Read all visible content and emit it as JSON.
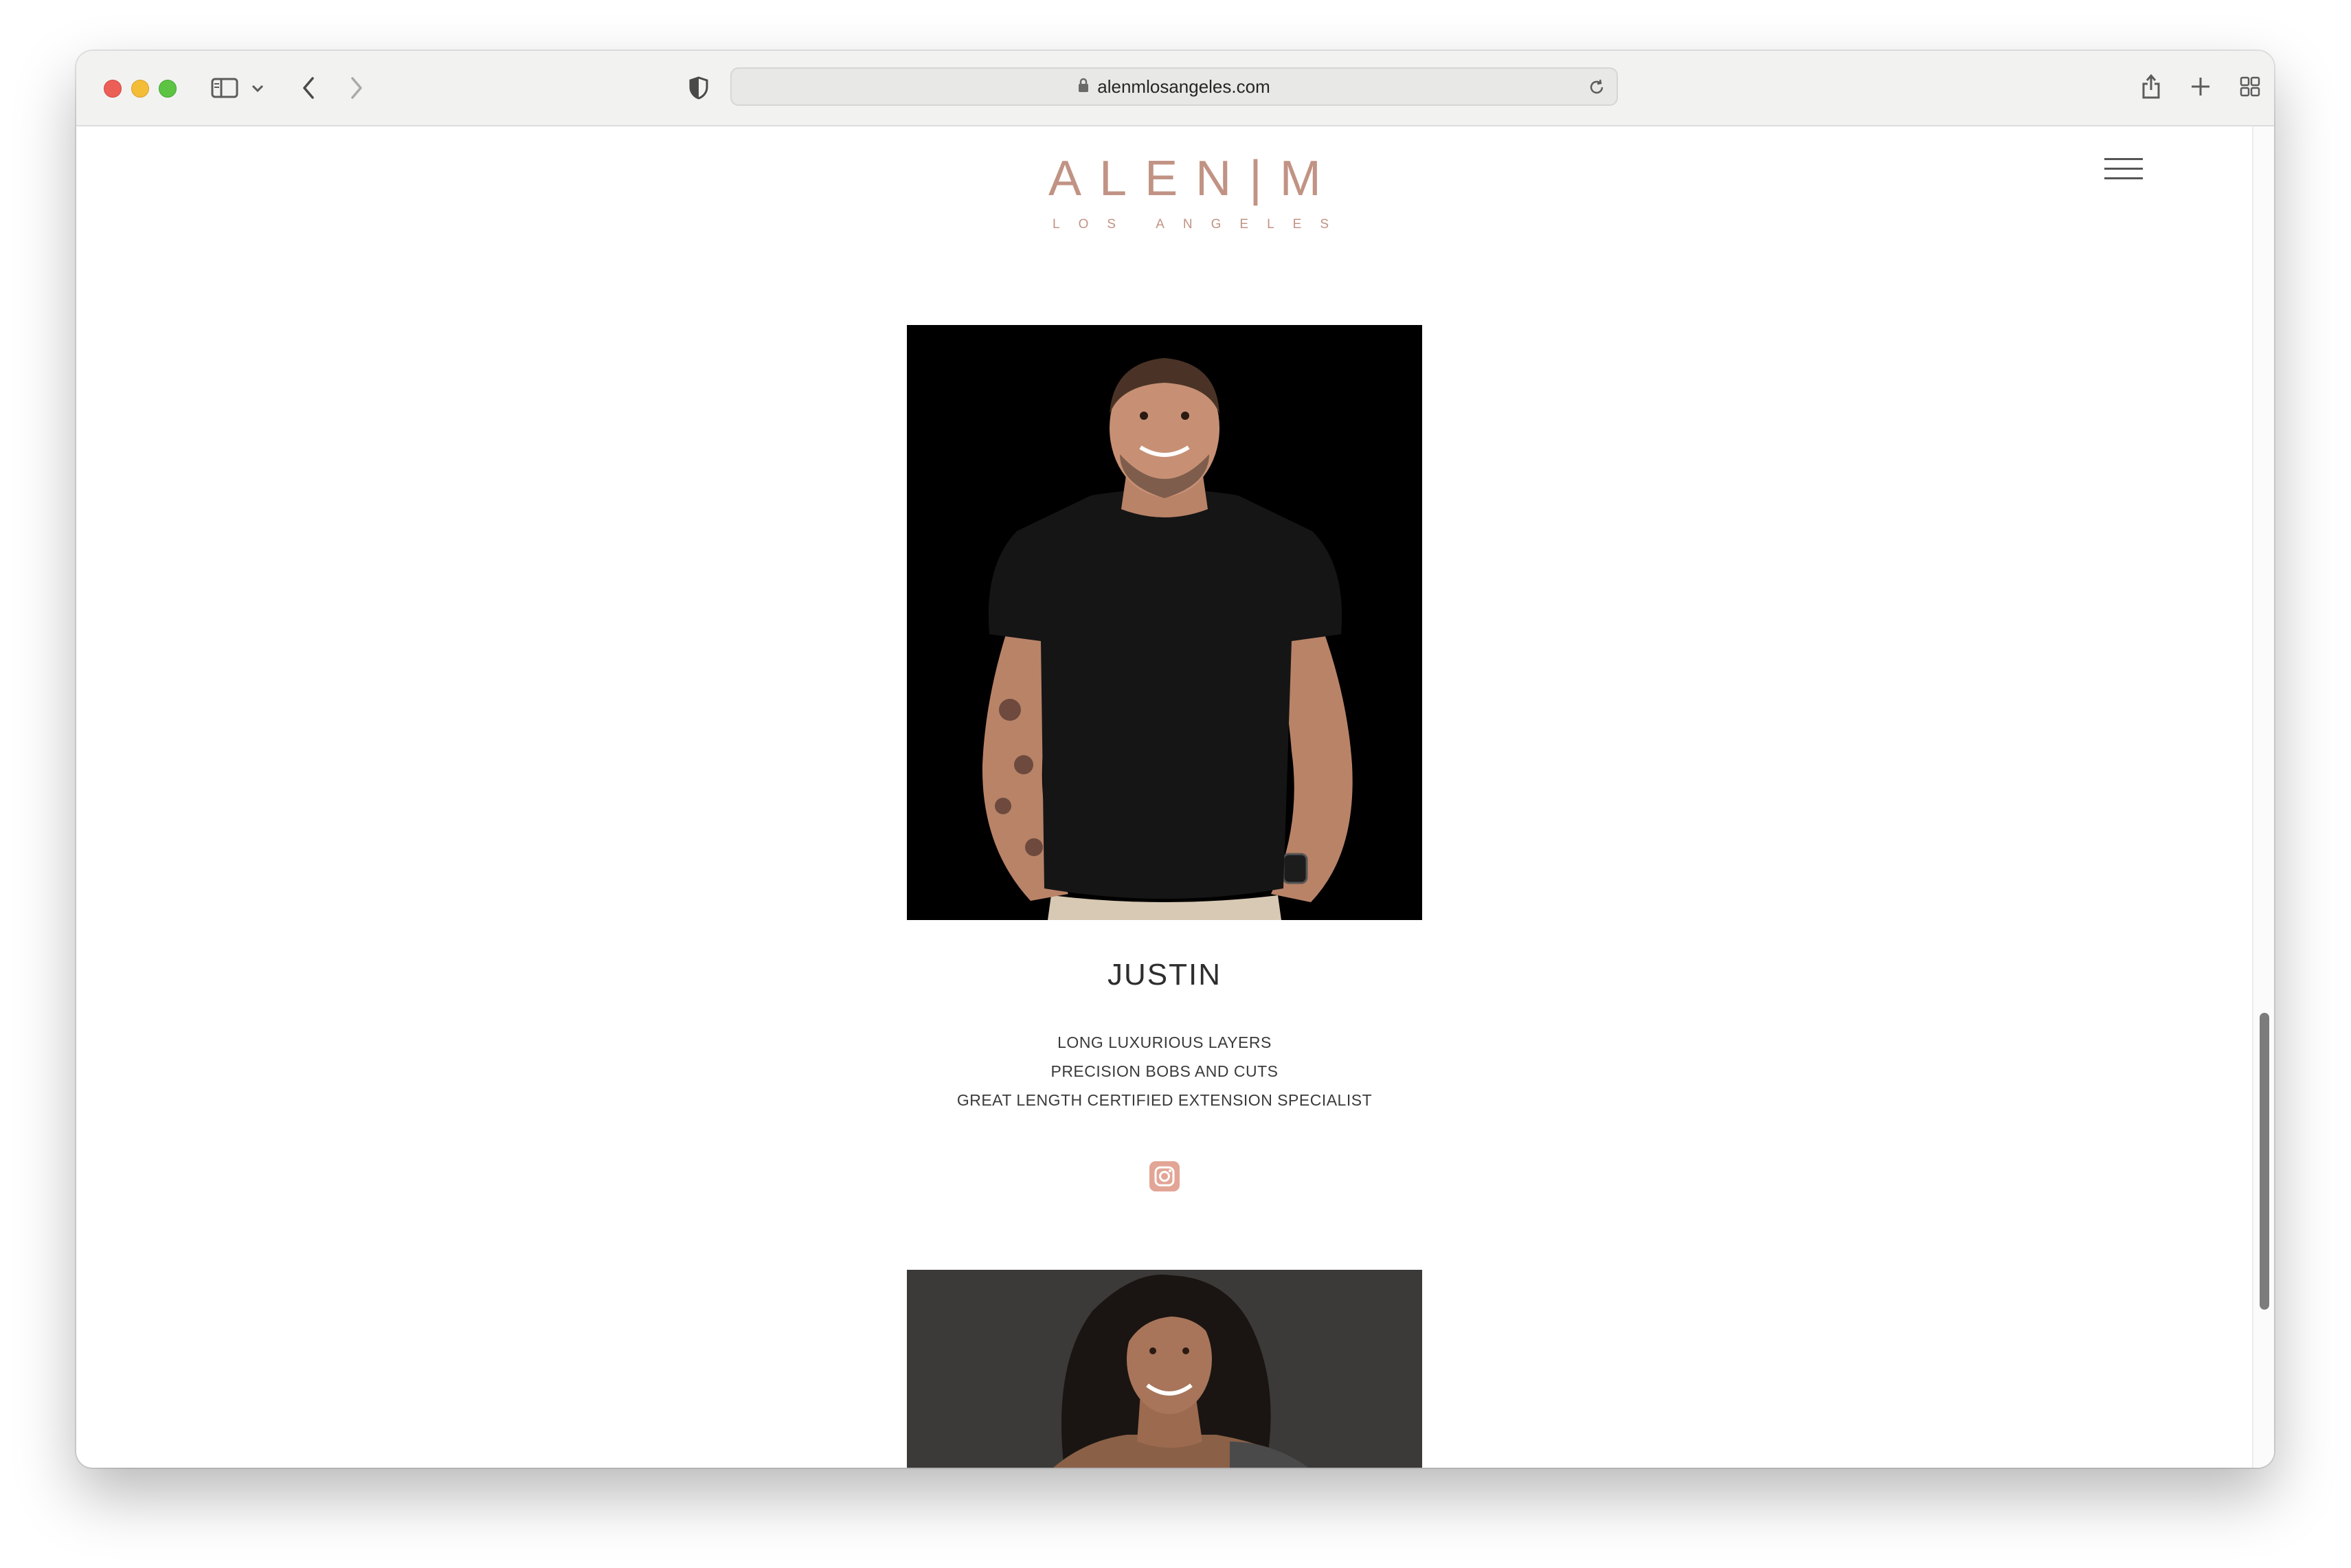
{
  "browser": {
    "url": "alenmlosangeles.com",
    "icons": {
      "sidebar": "sidebar-icon",
      "chevron": "chevron-down-icon",
      "back": "back-icon",
      "forward": "forward-icon",
      "privacy": "shield-icon",
      "lock": "lock-icon",
      "reload": "reload-icon",
      "share": "share-icon",
      "new_tab": "plus-icon",
      "tabs": "tab-overview-icon"
    }
  },
  "site": {
    "logo_main": "ALEN|M",
    "logo_sub": "LOS ANGELES",
    "brand_color": "#c19384",
    "menu_icon": "hamburger-icon"
  },
  "stylists": [
    {
      "name": "JUSTIN",
      "specialties": [
        "LONG LUXURIOUS LAYERS",
        "PRECISION BOBS AND CUTS",
        "GREAT LENGTH CERTIFIED EXTENSION SPECIALIST"
      ],
      "social_icon": "instagram-icon"
    }
  ]
}
